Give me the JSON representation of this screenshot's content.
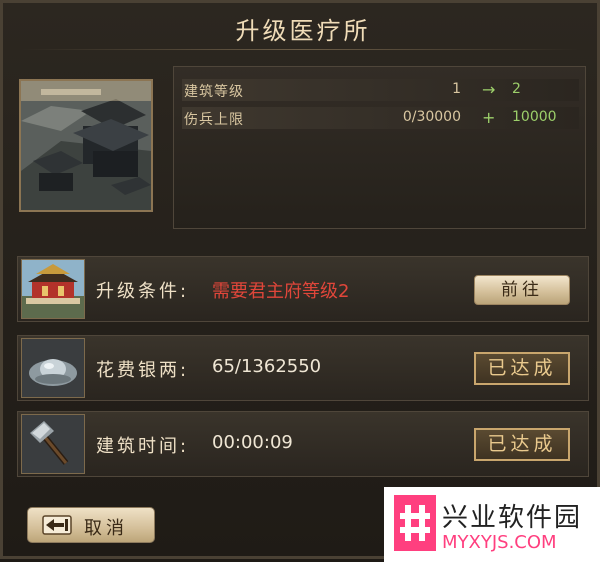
{
  "title": "升级医疗所",
  "info": {
    "rows": [
      {
        "label": "建筑等级",
        "current": "1",
        "symbol": "→",
        "next": "2"
      },
      {
        "label": "伤兵上限",
        "current": "0/30000",
        "symbol": "+",
        "next": "10000"
      }
    ]
  },
  "requirements": [
    {
      "label": "升级条件:",
      "value": "需要君主府等级2",
      "value_color": "#e0463a",
      "button": "前往"
    },
    {
      "label": "花费银两:",
      "value": "65/1362550",
      "value_color": "#efe6d4",
      "button": "已达成"
    },
    {
      "label": "建筑时间:",
      "value": "00:00:09",
      "value_color": "#efe6d4",
      "button": "已达成"
    }
  ],
  "cancel_label": "取消",
  "watermark": {
    "title": "兴业软件园",
    "url": "MYXYJS.COM"
  },
  "colors": {
    "green": "#9ccf6a",
    "red": "#e0463a",
    "gold": "#e9c98d"
  }
}
